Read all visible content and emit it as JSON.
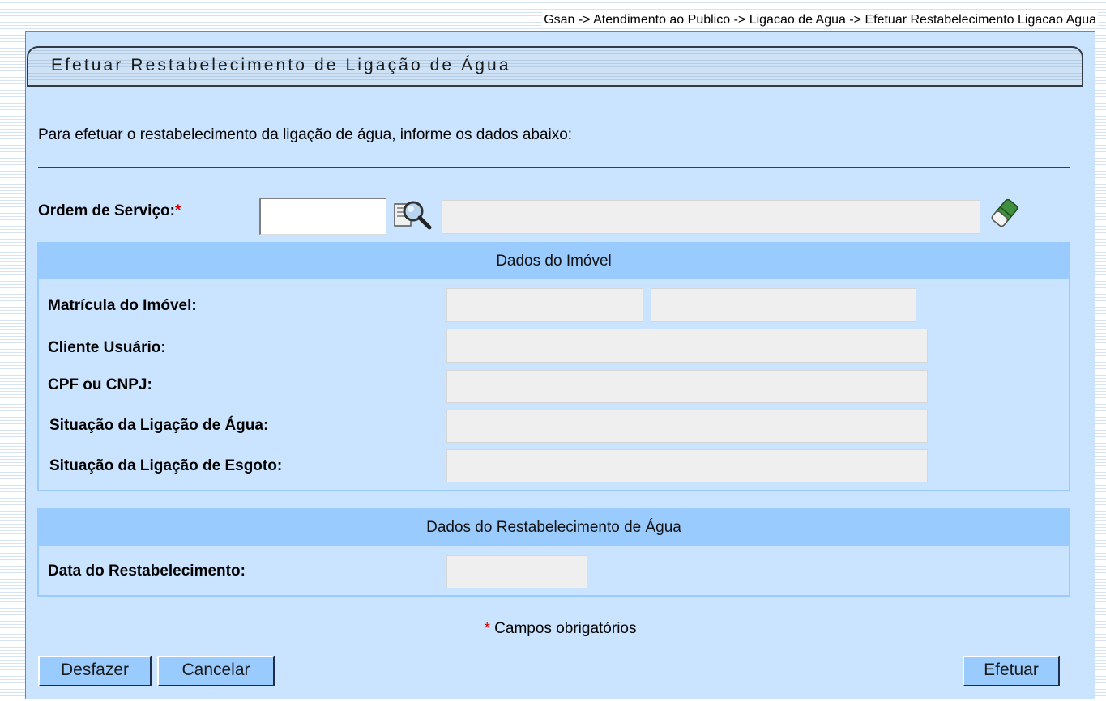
{
  "breadcrumb": "Gsan -> Atendimento ao Publico -> Ligacao de Agua -> Efetuar Restabelecimento Ligacao Agua",
  "page": {
    "title": "Efetuar Restabelecimento de Ligação de Água",
    "intro": "Para efetuar o restabelecimento da ligação de água, informe os dados abaixo:"
  },
  "ordem_servico": {
    "label": "Ordem de Serviço:",
    "required_mark": "*",
    "value": "",
    "description": "",
    "search_icon": "magnifier-icon",
    "clear_icon": "eraser-icon"
  },
  "dados_imovel": {
    "header": "Dados do Imóvel",
    "matricula_label": "Matrícula do Imóvel:",
    "matricula_value": "",
    "matricula_extra": "",
    "cliente_label": "Cliente Usuário:",
    "cliente_value": "",
    "cpf_label": "CPF ou CNPJ:",
    "cpf_value": "",
    "sit_agua_label": "Situação da Ligação de Água:",
    "sit_agua_value": "",
    "sit_esgoto_label": "Situação da Ligação de Esgoto:",
    "sit_esgoto_value": ""
  },
  "dados_restabelecimento": {
    "header": "Dados do Restabelecimento de Água",
    "data_label": "Data do Restabelecimento:",
    "data_value": ""
  },
  "footer": {
    "required_mark": "*",
    "note": " Campos obrigatórios"
  },
  "buttons": {
    "desfazer": "Desfazer",
    "cancelar": "Cancelar",
    "efetuar": "Efetuar"
  },
  "colors": {
    "panel_bg": "#cae4ff",
    "header_bg": "#99cbff",
    "required": "#d40000"
  }
}
